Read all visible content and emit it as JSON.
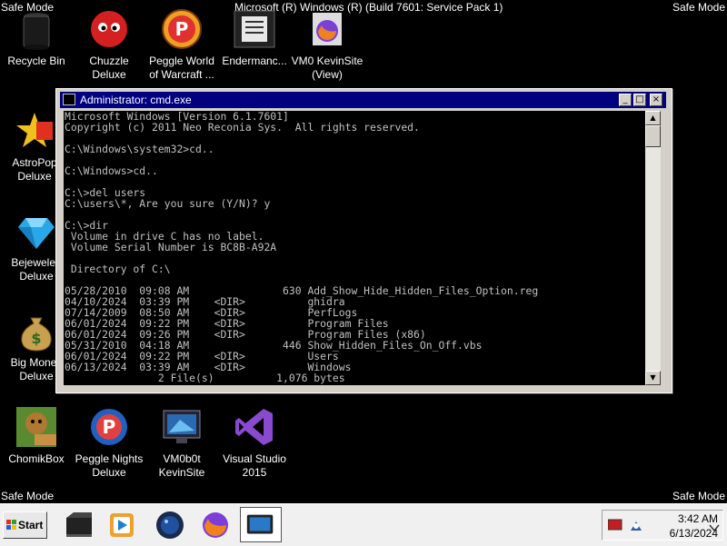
{
  "safe_mode_label": "Safe Mode",
  "window_caption": "Microsoft (R) Windows (R) (Build 7601: Service Pack 1)",
  "desktop_icons": [
    {
      "label1": "Recycle Bin",
      "label2": "",
      "icon": "recycle-bin-icon"
    },
    {
      "label1": "Chuzzle",
      "label2": "Deluxe",
      "icon": "chuzzle-icon"
    },
    {
      "label1": "Peggle World",
      "label2": "of Warcraft ...",
      "icon": "peggle-icon"
    },
    {
      "label1": "Endermanc...",
      "label2": "",
      "icon": "document-icon"
    },
    {
      "label1": "VM0 KevinSite",
      "label2": "(View)",
      "icon": "firefox-icon"
    },
    {
      "label1": "AstroPop",
      "label2": "Deluxe",
      "icon": "astropop-icon"
    },
    {
      "label1": "Bejeweled",
      "label2": "Deluxe",
      "icon": "bejeweled-icon"
    },
    {
      "label1": "Big Money",
      "label2": "Deluxe",
      "icon": "money-bag-icon"
    },
    {
      "label1": "ChomikBox",
      "label2": "",
      "icon": "chomikbox-icon"
    },
    {
      "label1": "Peggle Nights",
      "label2": "Deluxe",
      "icon": "peggle-nights-icon"
    },
    {
      "label1": "VM0b0t",
      "label2": "KevinSite",
      "icon": "vm-monitor-icon"
    },
    {
      "label1": "Visual Studio",
      "label2": "2015",
      "icon": "visual-studio-icon"
    }
  ],
  "cmd": {
    "title": "Administrator: cmd.exe",
    "minimize": "_",
    "maximize": "□",
    "close": "×",
    "lines": [
      "Microsoft Windows [Version 6.1.7601]",
      "Copyright (c) 2011 Neo Reconia Sys.  All rights reserved.",
      "",
      "C:\\Windows\\system32>cd..",
      "",
      "C:\\Windows>cd..",
      "",
      "C:\\>del users",
      "C:\\users\\*, Are you sure (Y/N)? y",
      "",
      "C:\\>dir",
      " Volume in drive C has no label.",
      " Volume Serial Number is BC8B-A92A",
      "",
      " Directory of C:\\",
      "",
      "05/28/2010  09:08 AM               630 Add_Show_Hide_Hidden_Files_Option.reg",
      "04/10/2024  03:39 PM    <DIR>          ghidra",
      "07/14/2009  08:50 AM    <DIR>          PerfLogs",
      "06/01/2024  09:22 PM    <DIR>          Program Files",
      "06/01/2024  09:26 PM    <DIR>          Program Files (x86)",
      "05/31/2010  04:18 AM               446 Show_Hidden_Files_On_Off.vbs",
      "06/01/2024  09:22 PM    <DIR>          Users",
      "06/13/2024  03:39 AM    <DIR>          Windows",
      "               2 File(s)          1,076 bytes"
    ]
  },
  "taskbar": {
    "start_label": "Start",
    "time": "3:42 AM",
    "date": "6/13/2024"
  },
  "colors": {
    "title_bar": "#000080",
    "console_text": "#c0c0c0",
    "console_bg": "#000000"
  }
}
